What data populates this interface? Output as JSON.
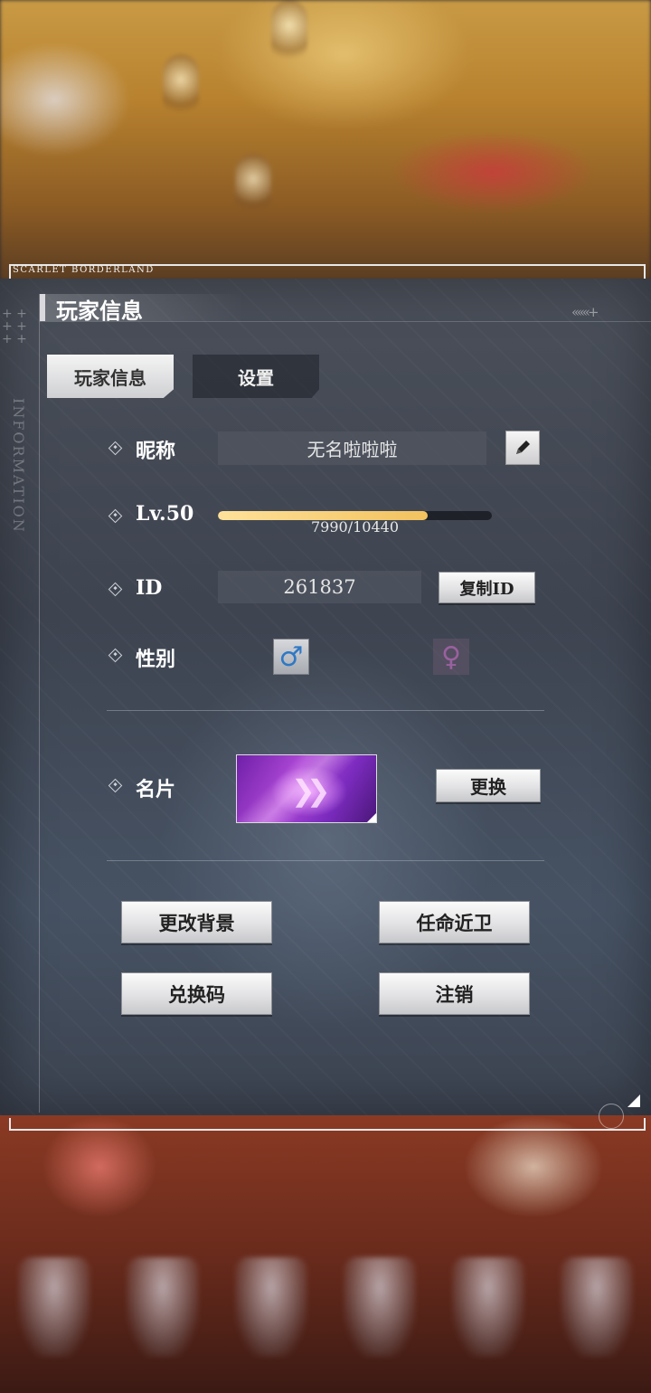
{
  "brand": "SCARLET BORDERLAND",
  "side_text": "INFORMATION",
  "header": {
    "title": "玩家信息"
  },
  "tabs": [
    {
      "label": "玩家信息",
      "active": true
    },
    {
      "label": "设置",
      "active": false
    }
  ],
  "nickname": {
    "label": "昵称",
    "value": "无名啦啦啦",
    "edit_icon": "pencil-icon"
  },
  "level": {
    "label": "Lv.50",
    "xp_current": 7990,
    "xp_max": 10440,
    "xp_text": "7990/10440",
    "xp_fraction": 0.765,
    "bar_color": "#f2c25e"
  },
  "id_row": {
    "label": "ID",
    "value": "261837",
    "copy_label": "复制ID"
  },
  "gender": {
    "label": "性别",
    "male_symbol": "♂",
    "female_symbol": "♀",
    "selected": "male"
  },
  "card": {
    "label": "名片",
    "change_label": "更换"
  },
  "actions": {
    "change_background": "更改背景",
    "appoint_guard": "任命近卫",
    "redeem_code": "兑换码",
    "logout": "注销"
  },
  "colors": {
    "panel": "#434955",
    "accent_bar": "#f2c25e",
    "male": "#2f78c4"
  }
}
